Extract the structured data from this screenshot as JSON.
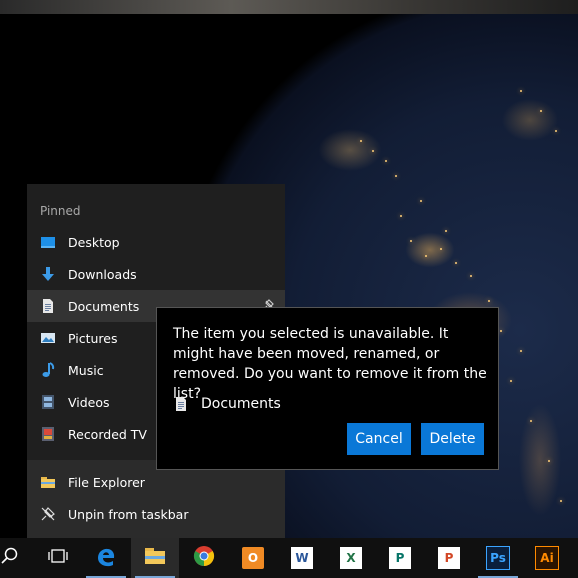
{
  "jumplist": {
    "section_header": "Pinned",
    "pinned": [
      {
        "label": "Desktop",
        "icon": "desktop-icon"
      },
      {
        "label": "Downloads",
        "icon": "download-arrow-icon"
      },
      {
        "label": "Documents",
        "icon": "document-icon"
      },
      {
        "label": "Pictures",
        "icon": "pictures-icon"
      },
      {
        "label": "Music",
        "icon": "music-note-icon"
      },
      {
        "label": "Videos",
        "icon": "videos-icon"
      },
      {
        "label": "Recorded TV",
        "icon": "recorded-tv-icon"
      }
    ],
    "actions": [
      {
        "label": "File Explorer",
        "icon": "folder-icon"
      },
      {
        "label": "Unpin from taskbar",
        "icon": "unpin-icon"
      }
    ]
  },
  "dialog": {
    "message": "The item you selected is unavailable. It might have been moved, renamed, or removed. Do you want to remove it from the list?",
    "item_name": "Documents",
    "cancel_label": "Cancel",
    "delete_label": "Delete"
  },
  "taskbar": {
    "apps": [
      {
        "name": "Search",
        "icon": "search-icon"
      },
      {
        "name": "Task View",
        "icon": "task-view-icon"
      },
      {
        "name": "Edge",
        "icon": "edge-icon"
      },
      {
        "name": "File Explorer",
        "icon": "folder-icon"
      },
      {
        "name": "Chrome",
        "icon": "chrome-icon"
      },
      {
        "name": "Outlook",
        "icon": "outlook-icon",
        "letter": "O"
      },
      {
        "name": "Word",
        "icon": "word-icon",
        "letter": "W"
      },
      {
        "name": "Excel",
        "icon": "excel-icon",
        "letter": "X"
      },
      {
        "name": "Publisher",
        "icon": "publisher-icon",
        "letter": "P"
      },
      {
        "name": "PowerPoint",
        "icon": "powerpoint-icon",
        "letter": "P"
      },
      {
        "name": "Photoshop",
        "icon": "photoshop-icon",
        "letter": "Ps"
      },
      {
        "name": "Illustrator",
        "icon": "illustrator-icon",
        "letter": "Ai"
      }
    ]
  },
  "colors": {
    "accent": "#0a78d7",
    "jumplist_bg": "#1f1f1f",
    "taskbar_bg": "#101010"
  }
}
